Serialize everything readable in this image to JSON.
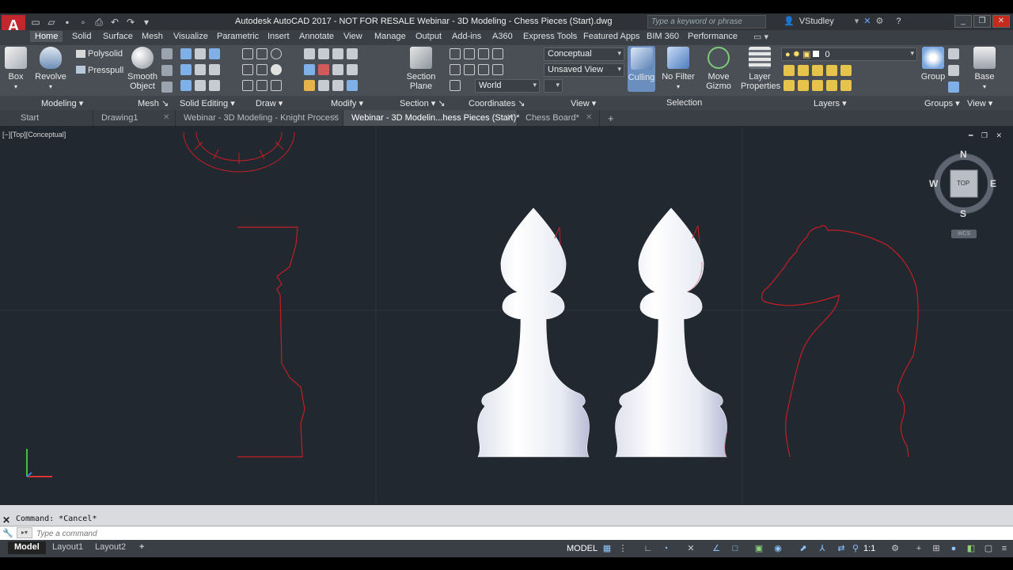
{
  "app": {
    "logo": "A",
    "title": "Autodesk AutoCAD 2017 - NOT FOR RESALE    Webinar - 3D Modeling - Chess Pieces (Start).dwg",
    "search_placeholder": "Type a keyword or phrase",
    "user": "VStudley"
  },
  "ribbon_tabs": [
    "Home",
    "Solid",
    "Surface",
    "Mesh",
    "Visualize",
    "Parametric",
    "Insert",
    "Annotate",
    "View",
    "Manage",
    "Output",
    "Add-ins",
    "A360",
    "Express Tools",
    "Featured Apps",
    "BIM 360",
    "Performance"
  ],
  "ribbon": {
    "box": "Box",
    "revolve": "Revolve",
    "polysolid": "Polysolid",
    "presspull": "Presspull",
    "smooth_object_1": "Smooth",
    "smooth_object_2": "Object",
    "section_plane_1": "Section",
    "section_plane_2": "Plane",
    "visual_style": "Conceptual",
    "view_name": "Unsaved View",
    "ucs": "World",
    "culling": "Culling",
    "no_filter": "No Filter",
    "move_gizmo_1": "Move",
    "move_gizmo_2": "Gizmo",
    "layer_properties_1": "Layer",
    "layer_properties_2": "Properties",
    "layer_current": "0",
    "group": "Group",
    "base": "Base",
    "panels": {
      "modeling": "Modeling",
      "mesh": "Mesh",
      "solid_editing": "Solid Editing",
      "draw": "Draw",
      "modify": "Modify",
      "section": "Section",
      "coordinates": "Coordinates",
      "view": "View",
      "selection": "Selection",
      "layers": "Layers",
      "groups": "Groups",
      "view2": "View"
    }
  },
  "file_tabs": [
    "Start",
    "Drawing1",
    "Webinar - 3D Modeling - Knight Process",
    "Webinar - 3D Modelin...hess Pieces (Start)*",
    "Chess Board*"
  ],
  "viewport": {
    "label": "[−][Top][Conceptual]",
    "viewcube": {
      "n": "N",
      "s": "S",
      "e": "E",
      "w": "W",
      "face": "TOP",
      "wcs": "WCS"
    }
  },
  "command": {
    "history": "Command: *Cancel*",
    "placeholder": "Type a command"
  },
  "status": {
    "layouts": [
      "Model",
      "Layout1",
      "Layout2"
    ],
    "space": "MODEL",
    "scale": "1:1"
  },
  "colors": {
    "viewport_bg": "#212830",
    "outline_red": "#c41e24",
    "solid_white": "#eef0f6",
    "ribbon_bg": "#4a4f55"
  }
}
